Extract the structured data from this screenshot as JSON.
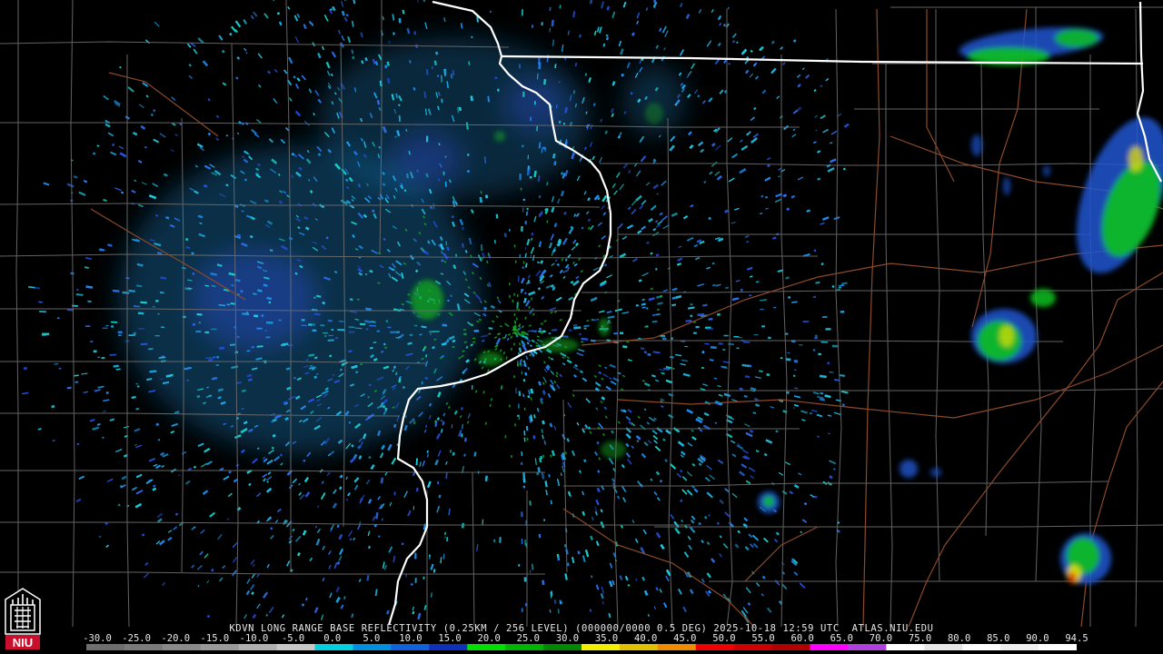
{
  "product": {
    "caption": "KDVN LONG RANGE BASE REFLECTIVITY (0.25KM / 256 LEVEL) (000000/0000 0.5 DEG) 2025-10-18 12:59 UTC  ATLAS.NIU.EDU"
  },
  "logo": {
    "text": "NIU",
    "background": "#c8102e"
  },
  "scale": {
    "labels": [
      "-30.0",
      "-25.0",
      "-20.0",
      "-15.0",
      "-10.0",
      "-5.0",
      "0.0",
      "5.0",
      "10.0",
      "15.0",
      "20.0",
      "25.0",
      "30.0",
      "35.0",
      "40.0",
      "45.0",
      "50.0",
      "55.0",
      "60.0",
      "65.0",
      "70.0",
      "75.0",
      "80.0",
      "85.0",
      "90.0",
      "94.5"
    ],
    "colors": [
      "#6e6e6e",
      "#7a7a7a",
      "#8a8a8a",
      "#9a9a9a",
      "#b0b0b0",
      "#c8c8c8",
      "#00d0e0",
      "#0090e0",
      "#1060e0",
      "#1030c0",
      "#00e000",
      "#00b400",
      "#008800",
      "#f0f000",
      "#e0c000",
      "#f08c00",
      "#f00000",
      "#d00000",
      "#b00000",
      "#ff00ff",
      "#b040e0",
      "#ffffff",
      "#e8e8e8",
      "#ffffff",
      "#f0f0f0",
      "#ffffff"
    ]
  },
  "colors": {
    "background": "#000000",
    "county_lines": "#6e6e6e",
    "state_lines": "#ffffff",
    "roads": "#8b4a2a",
    "echo_light": "#20a8e0",
    "echo_blue": "#2050d0",
    "echo_green": "#10c020",
    "echo_yellow": "#e8e000",
    "echo_red": "#e01010"
  }
}
